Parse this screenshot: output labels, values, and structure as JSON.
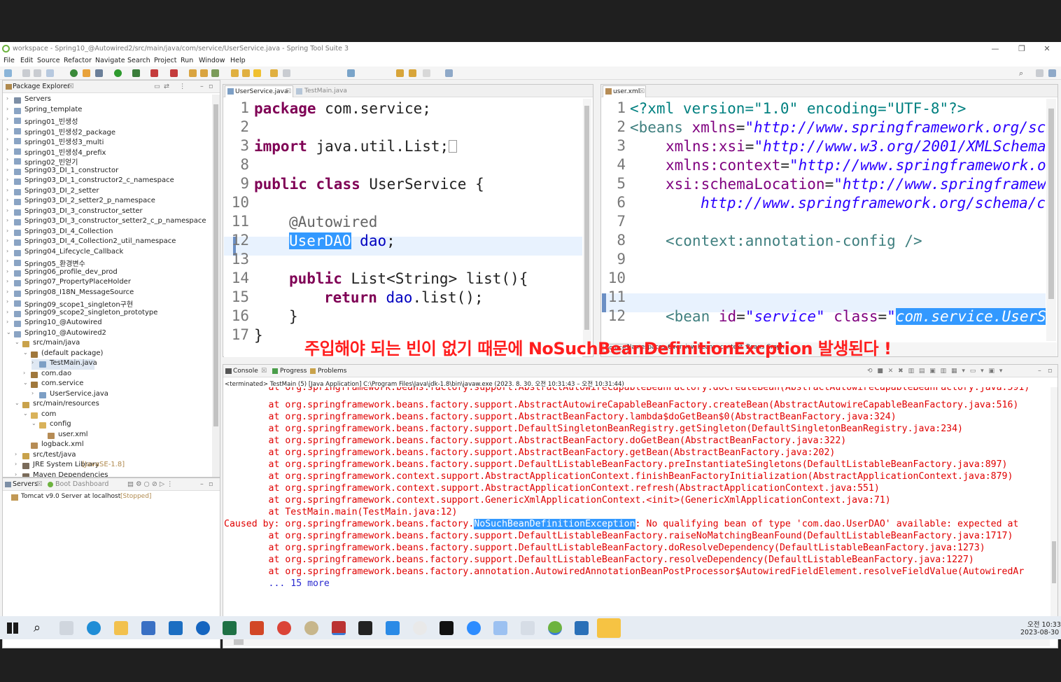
{
  "window": {
    "title": "workspace - Spring10_@Autowired2/src/main/java/com/service/UserService.java - Spring Tool Suite 3"
  },
  "menu": [
    "File",
    "Edit",
    "Source",
    "Refactor",
    "Navigate",
    "Search",
    "Project",
    "Run",
    "Window",
    "Help"
  ],
  "package_explorer": {
    "title": "Package Explorer",
    "items": [
      "Servers",
      "Spring_template",
      "spring01_빈생성",
      "spring01_빈생성2_package",
      "spring01_빈생성3_multi",
      "spring01_빈생성4_prefix",
      "spring02_빈얻기",
      "Spring03_DI_1_constructor",
      "Spring03_DI_1_constructor2_c_namespace",
      "Spring03_DI_2_setter",
      "Spring03_DI_2_setter2_p_namespace",
      "Spring03_DI_3_constructor_setter",
      "Spring03_DI_3_constructor_setter2_c_p_namespace",
      "Spring03_DI_4_Collection",
      "Spring03_DI_4_Collection2_util_namespace",
      "Spring04_Lifecycle_Callback",
      "Spring05_환경변수",
      "Spring06_profile_dev_prod",
      "Spring07_PropertyPlaceHolder",
      "Spring08_I18N_MessageSource",
      "Spring09_scope1_singleton구현",
      "Spring09_scope2_singleton_prototype",
      "Spring10_@Autowired",
      "Spring10_@Autowired2",
      "src/main/java",
      "(default package)",
      "TestMain.java",
      "com.dao",
      "com.service",
      "UserService.java",
      "src/main/resources",
      "com",
      "config",
      "user.xml",
      "logback.xml",
      "src/test/java",
      "JRE System Library",
      "[JavaSE-1.8]",
      "Maven Dependencies"
    ]
  },
  "servers": {
    "tab": "Servers",
    "tab2": "Boot Dashboard",
    "item": "Tomcat v9.0 Server at localhost",
    "status": "[Stopped]"
  },
  "java_editor": {
    "tab1": "UserService.java",
    "tab2": "TestMain.java",
    "line_numbers": [
      "1",
      "2",
      "3",
      "8",
      "9",
      "10",
      "11",
      "12",
      "13",
      "14",
      "15",
      "16",
      "17"
    ],
    "l1_kw": "package",
    "l1_rest": " com.service;",
    "l3_kw": "import",
    "l3_rest": " java.util.List;",
    "l9_kw1": "public",
    "l9_kw2": "class",
    "l9_rest": " UserService {",
    "l11": "@Autowired",
    "l12_sel": "UserDAO",
    "l12_fld": "dao",
    "l12_end": ";",
    "l14_kw": "public",
    "l14_rest": " List<String> list(){",
    "l15_kw": "return",
    "l15_fld": "dao",
    "l15_rest": ".list();",
    "l16": "}",
    "l17": "}"
  },
  "xml_editor": {
    "tab": "user.xml",
    "line_numbers": [
      "1",
      "2",
      "3",
      "4",
      "5",
      "6",
      "7",
      "8",
      "9",
      "10",
      "11",
      "12"
    ],
    "l1": "<?xml version=\"1.0\" encoding=\"UTF-8\"?>",
    "l2_tag": "<beans",
    "l2_attr": "xmlns",
    "l2_val": "\"http://www.springframework.org/sc",
    "l3_attr": "xmlns:xsi",
    "l3_val": "\"http://www.w3.org/2001/XMLSchema",
    "l4_attr": "xmlns:context",
    "l4_val": "\"http://www.springframework.o",
    "l5_attr": "xsi:schemaLocation",
    "l5_val": "\"http://www.springframew",
    "l6_val": "http://www.springframework.org/schema/c",
    "l8": "<context:annotation-config />",
    "l12_tag": "<bean",
    "l12_id": "id",
    "l12_idval": "\"service\"",
    "l12_class": "class",
    "l12_q": "\"",
    "l12_sel": "com.service.UserS",
    "bottom_tabs": [
      "Source",
      "Namespaces",
      "Overview",
      "beans",
      "context",
      "Beans Graph"
    ]
  },
  "overlay_note": "주입해야 되는 빈이 없기 때문에 NoSuchBeanDefinitionExcption 발생된다 !",
  "console": {
    "tabs": [
      "Console",
      "Progress",
      "Problems"
    ],
    "status": "<terminated> TestMain (5) [Java Application] C:\\Program Files\\Java\\jdk-1.8\\bin\\javaw.exe  (2023. 8. 30. 오전 10:31:43 – 오전 10:31:44)",
    "lines": [
      "        at org.springframework.beans.factory.support.AbstractAutowireCapableBeanFactory.createBean(AbstractAutowireCapableBeanFactory.java:516)",
      "        at org.springframework.beans.factory.support.AbstractBeanFactory.lambda$doGetBean$0(AbstractBeanFactory.java:324)",
      "        at org.springframework.beans.factory.support.DefaultSingletonBeanRegistry.getSingleton(DefaultSingletonBeanRegistry.java:234)",
      "        at org.springframework.beans.factory.support.AbstractBeanFactory.doGetBean(AbstractBeanFactory.java:322)",
      "        at org.springframework.beans.factory.support.AbstractBeanFactory.getBean(AbstractBeanFactory.java:202)",
      "        at org.springframework.beans.factory.support.DefaultListableBeanFactory.preInstantiateSingletons(DefaultListableBeanFactory.java:897)",
      "        at org.springframework.context.support.AbstractApplicationContext.finishBeanFactoryInitialization(AbstractApplicationContext.java:879)",
      "        at org.springframework.context.support.AbstractApplicationContext.refresh(AbstractApplicationContext.java:551)",
      "        at org.springframework.context.support.GenericXmlApplicationContext.<init>(GenericXmlApplicationContext.java:71)",
      "        at TestMain.main(TestMain.java:12)"
    ],
    "caused_prefix": "Caused by: org.springframework.beans.factory.",
    "caused_sel": "NoSuchBeanDefinitionException",
    "caused_rest": ": No qualifying bean of type 'com.dao.UserDAO' available: expected at",
    "lines2": [
      "        at org.springframework.beans.factory.support.DefaultListableBeanFactory.raiseNoMatchingBeanFound(DefaultListableBeanFactory.java:1717)",
      "        at org.springframework.beans.factory.support.DefaultListableBeanFactory.doResolveDependency(DefaultListableBeanFactory.java:1273)",
      "        at org.springframework.beans.factory.support.DefaultListableBeanFactory.resolveDependency(DefaultListableBeanFactory.java:1227)",
      "        at org.springframework.beans.factory.annotation.AutowiredAnnotationBeanPostProcessor$AutowiredFieldElement.resolveFieldValue(AutowiredAr"
    ],
    "more": "        ... 15 more"
  },
  "taskbar": {
    "time": "오전 10:33",
    "date": "2023-08-30"
  }
}
